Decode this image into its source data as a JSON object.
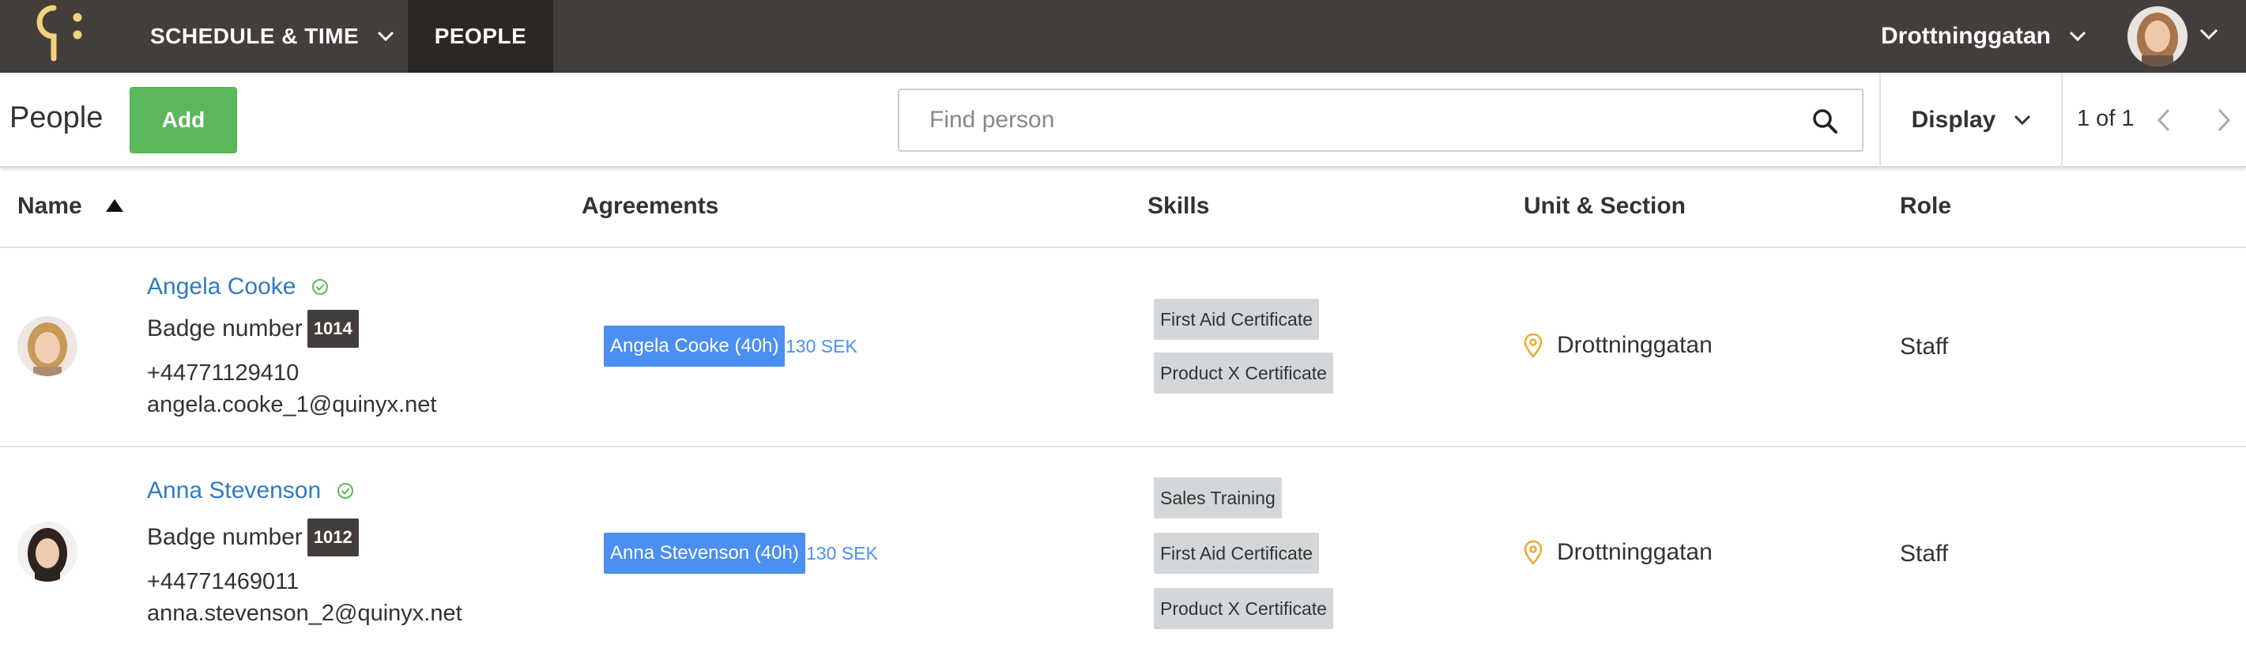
{
  "topnav": {
    "schedule_label": "SCHEDULE & TIME",
    "people_label": "PEOPLE",
    "location_label": "Drottninggatan",
    "bg_color": "#433e3b",
    "logo_color": "#f2d37b"
  },
  "toolbar": {
    "title": "People",
    "add_label": "Add",
    "search_placeholder": "Find person",
    "display_label": "Display",
    "pager_text": "1 of 1"
  },
  "table": {
    "columns": [
      "Name",
      "Agreements",
      "Skills",
      "Unit & Section",
      "Role"
    ],
    "sort": "name-ascending"
  },
  "people": [
    {
      "name": "Angela Cooke",
      "badge_label": "Badge number",
      "badge_number": "1014",
      "phone": "+44771129410",
      "email": "angela.cooke_1@quinyx.net",
      "agreement": "Angela Cooke (40h)",
      "rate": "130 SEK",
      "skills": [
        "First Aid Certificate",
        "Product X Certificate"
      ],
      "unit": "Drottninggatan",
      "role": "Staff"
    },
    {
      "name": "Anna Stevenson",
      "badge_label": "Badge number",
      "badge_number": "1012",
      "phone": "+44771469011",
      "email": "anna.stevenson_2@quinyx.net",
      "agreement": "Anna Stevenson (40h)",
      "rate": "130 SEK",
      "skills": [
        "Sales Training",
        "First Aid Certificate",
        "Product X Certificate"
      ],
      "unit": "Drottninggatan",
      "role": "Staff"
    }
  ],
  "colors": {
    "add_button": "#5cb85c",
    "link": "#2e7bc4",
    "agreement_tag": "#4b8ff0",
    "skill_tag": "#d4d7d9",
    "verified_check": "#5cb85c",
    "location_pin": "#f0a830"
  }
}
